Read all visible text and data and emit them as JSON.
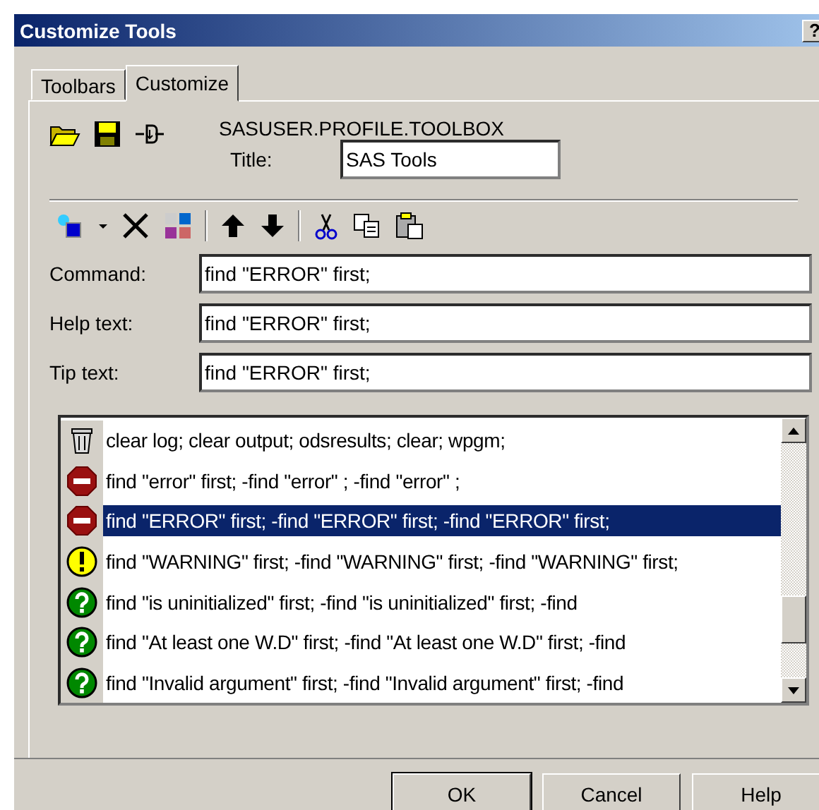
{
  "window": {
    "title": "Customize Tools",
    "help_button": "?"
  },
  "tabs": [
    {
      "label": "Toolbars",
      "selected": false
    },
    {
      "label": "Customize",
      "selected": true
    }
  ],
  "toolbox_name": "SASUSER.PROFILE.TOOLBOX",
  "title_field": {
    "label": "Title:",
    "value": "SAS Tools"
  },
  "fields": [
    {
      "label": "Command:",
      "value": "find \"ERROR\" first;"
    },
    {
      "label": "Help text:",
      "value": "find \"ERROR\" first;"
    },
    {
      "label": "Tip text:",
      "value": "find \"ERROR\" first;"
    }
  ],
  "tools": [
    {
      "kind": "trash",
      "text": "clear log; clear output; odsresults; clear; wpgm;",
      "selected": false
    },
    {
      "kind": "stop",
      "text": "find \"error\" first; -find \"error\" ; -find \"error\" ;",
      "selected": false
    },
    {
      "kind": "stop",
      "text": "find \"ERROR\" first; -find \"ERROR\" first; -find \"ERROR\" first;",
      "selected": true
    },
    {
      "kind": "warning",
      "text": "find \"WARNING\" first; -find \"WARNING\" first; -find \"WARNING\" first;",
      "selected": false
    },
    {
      "kind": "question",
      "text": "find \"is uninitialized\" first; -find \"is uninitialized\" first; -find",
      "selected": false
    },
    {
      "kind": "question",
      "text": "find \"At least one W.D\" first; -find \"At least one W.D\" first; -find",
      "selected": false
    },
    {
      "kind": "question",
      "text": "find \"Invalid argument\" first; -find \"Invalid argument\" first; -find",
      "selected": false
    }
  ],
  "buttons": [
    {
      "label": "OK",
      "default": true
    },
    {
      "label": "Cancel",
      "default": false
    },
    {
      "label": "Help",
      "default": false
    }
  ]
}
